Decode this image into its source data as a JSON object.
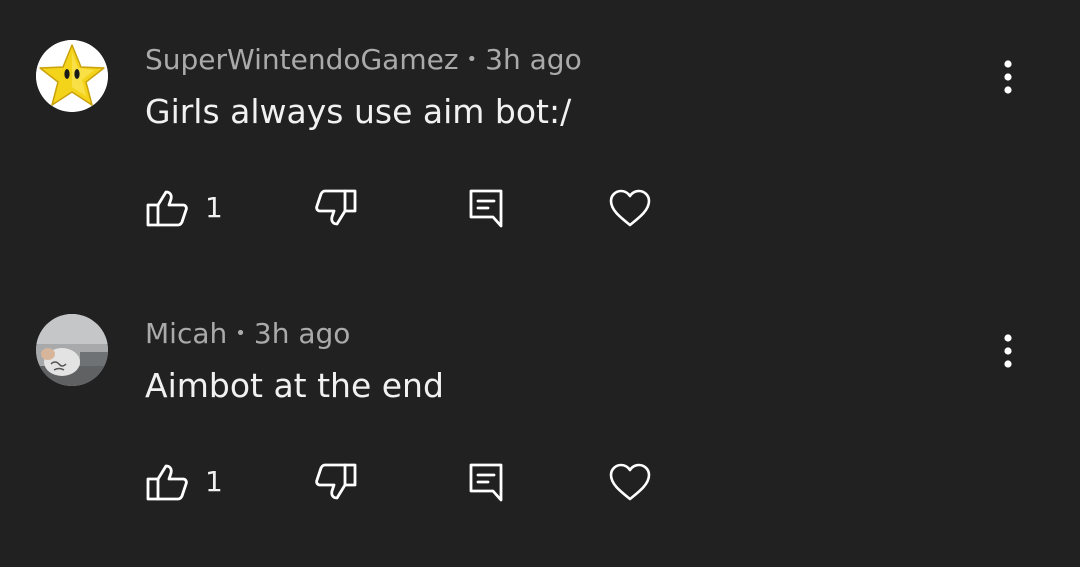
{
  "comments": [
    {
      "author": "SuperWintendoGamez",
      "separator": "•",
      "time": "3h ago",
      "text": "Girls always use aim bot:/",
      "likes": "1",
      "avatar": "star-avatar"
    },
    {
      "author": "Micah",
      "separator": "•",
      "time": "3h ago",
      "text": "Aimbot at the end",
      "likes": "1",
      "avatar": "photo-avatar"
    }
  ],
  "colors": {
    "background": "#212121",
    "primary_text": "#f1f1f1",
    "secondary_text": "#aaaaaa",
    "icon": "#ffffff"
  }
}
